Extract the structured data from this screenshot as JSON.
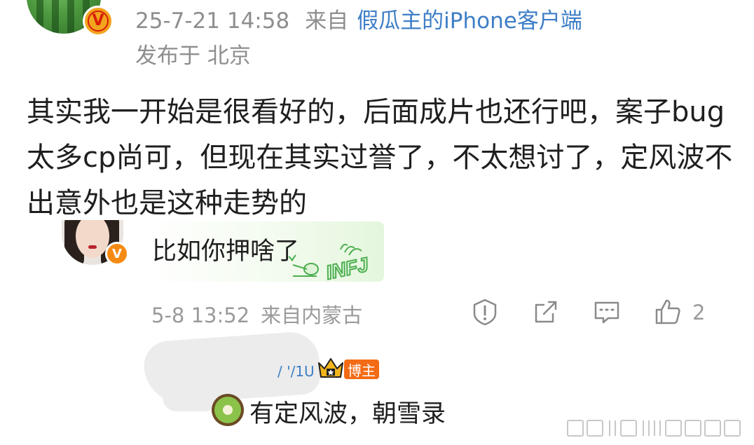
{
  "post": {
    "timestamp": "25-7-21 14:58",
    "source_prefix": "来自",
    "client": "假瓜主的iPhone客户端",
    "location": "发布于 北京",
    "text": "其实我一开始是很看好的，后面成片也还行吧，案子bug太多cp尚可，但现在其实过誉了，不太想讨了，定风波不出意外也是这种走势的",
    "badge": "V"
  },
  "reply": {
    "text": "比如你押啥了",
    "bubble_badge": "INFJ",
    "badge": "V",
    "timestamp": "5-8 13:52",
    "source": "来自内蒙古",
    "like_count": "2",
    "icons": [
      "report-icon",
      "share-icon",
      "comment-icon",
      "like-icon"
    ]
  },
  "sub_reply": {
    "nick_fragment": "/ '/1U",
    "tag": "博主",
    "text": "有定风波，朝雪录"
  },
  "colors": {
    "accent_blue": "#3d7ec6",
    "meta_gray": "#8e8e8e",
    "badge_orange": "#f36b16",
    "vip_gold": "#f2a41e"
  }
}
